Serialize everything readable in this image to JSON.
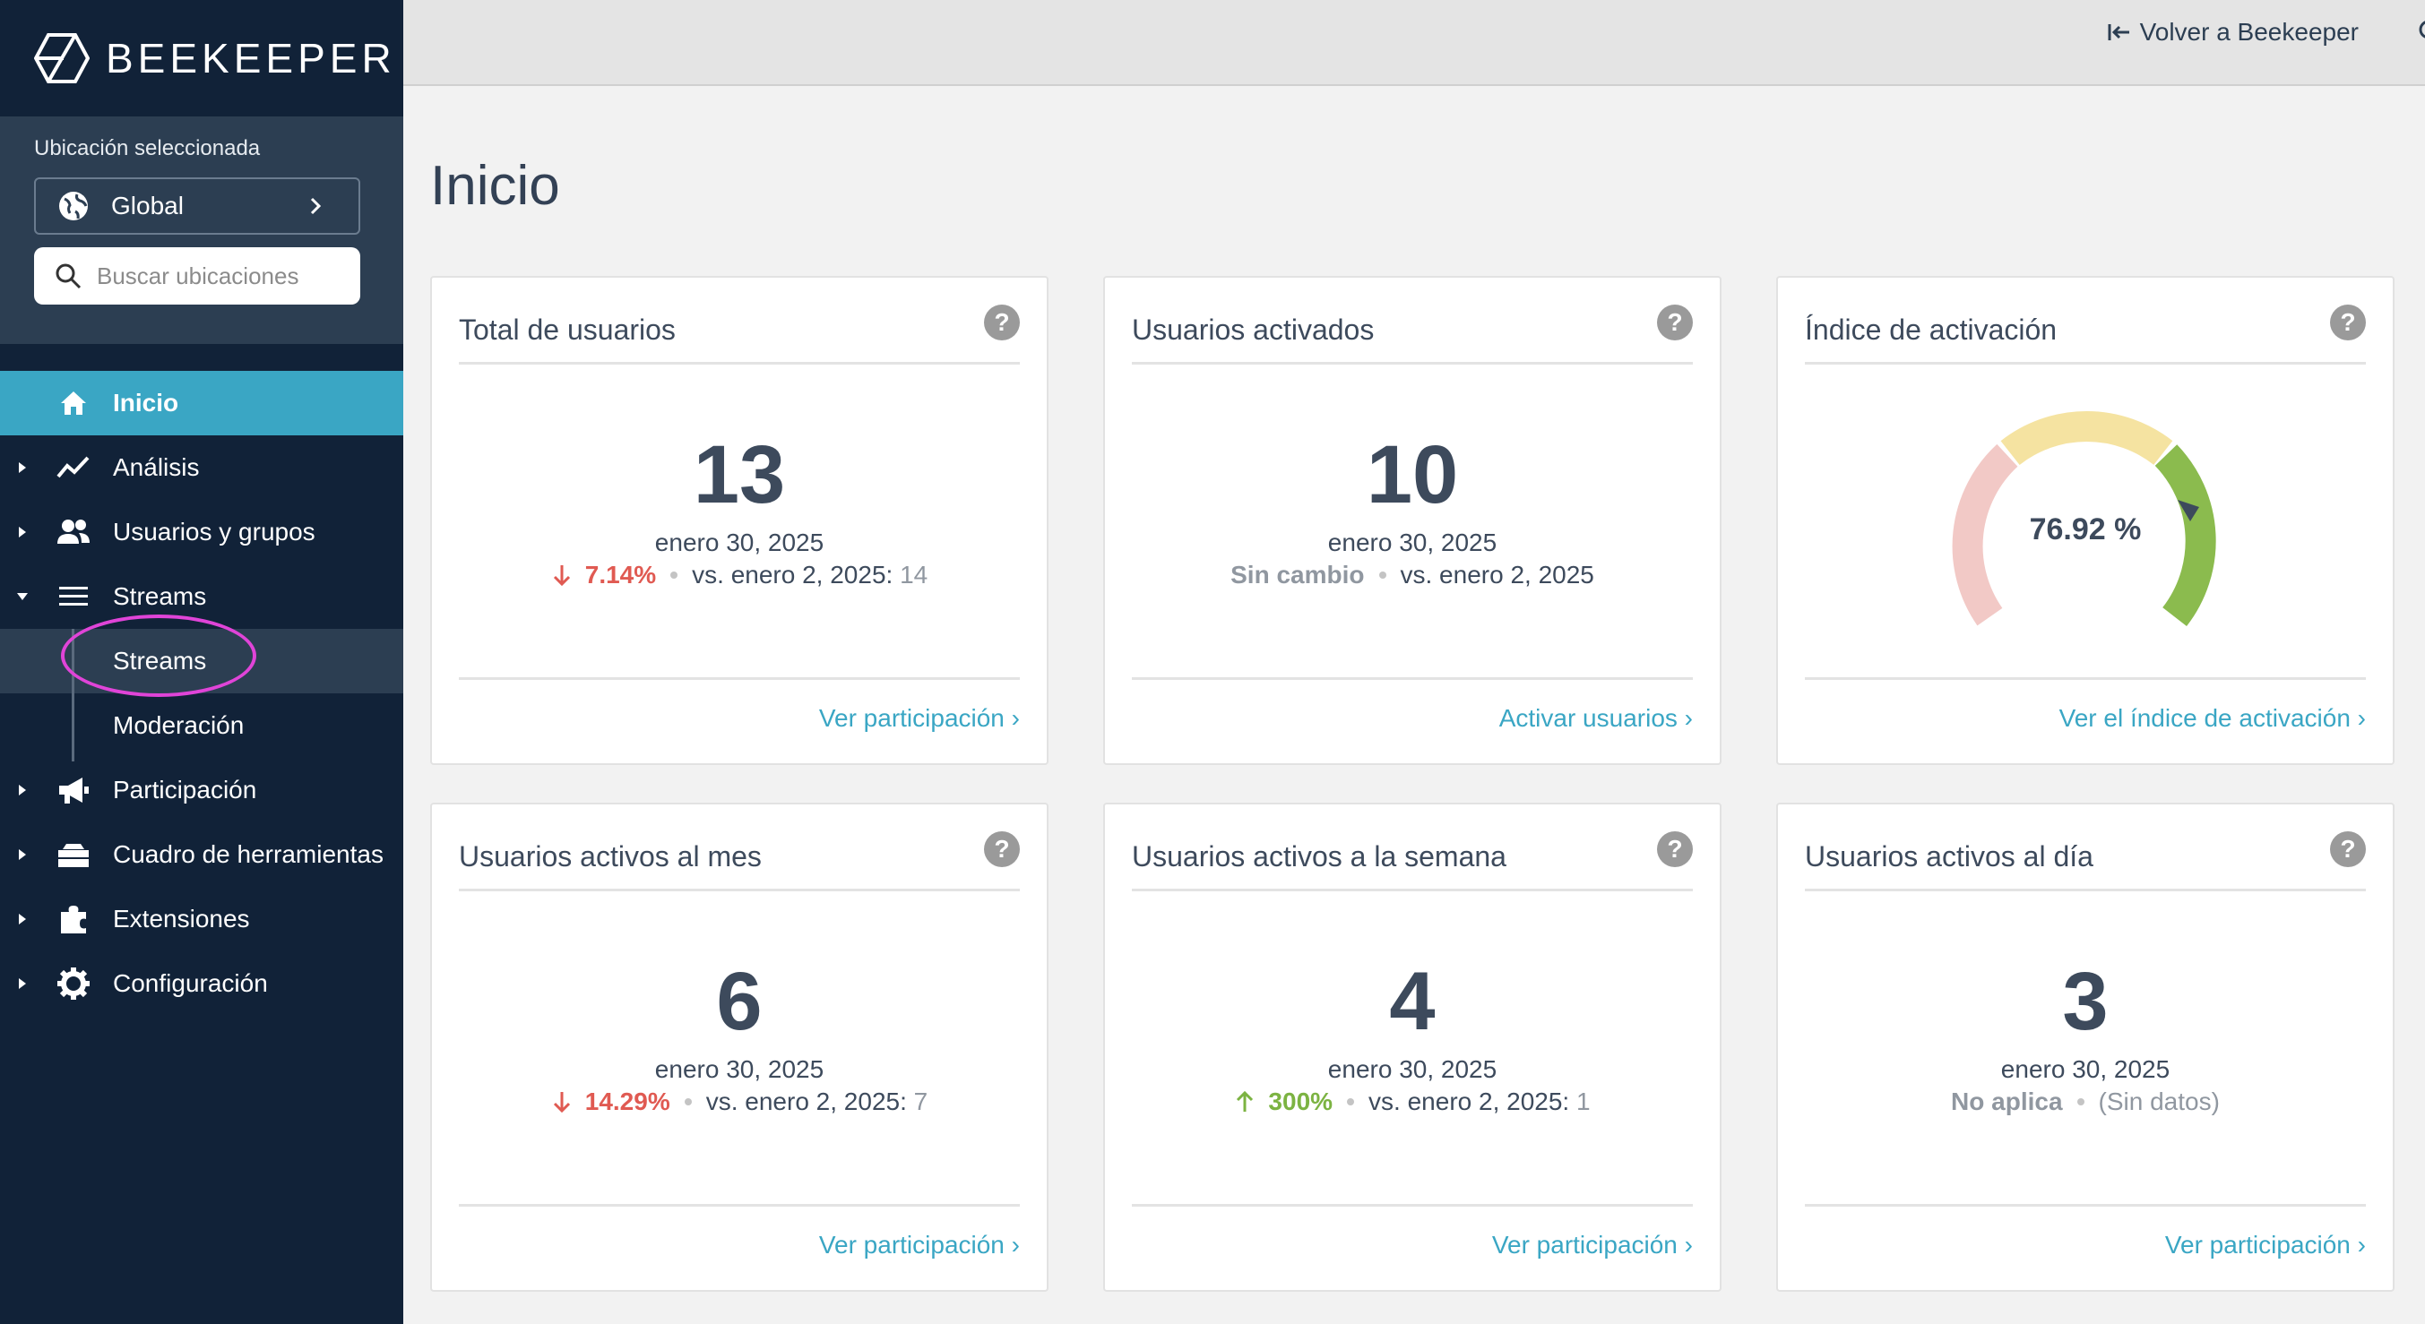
{
  "brand": {
    "name": "BEEKEEPER"
  },
  "location": {
    "label": "Ubicación seleccionada",
    "selected": "Global",
    "search_placeholder": "Buscar ubicaciones"
  },
  "nav": {
    "items": [
      {
        "label": "Inicio",
        "icon": "home-icon"
      },
      {
        "label": "Análisis",
        "icon": "chart-line-icon"
      },
      {
        "label": "Usuarios y grupos",
        "icon": "users-icon"
      },
      {
        "label": "Streams",
        "icon": "menu-lines-icon"
      },
      {
        "label": "Participación",
        "icon": "megaphone-icon"
      },
      {
        "label": "Cuadro de herramientas",
        "icon": "toolbox-icon"
      },
      {
        "label": "Extensiones",
        "icon": "puzzle-icon"
      },
      {
        "label": "Configuración",
        "icon": "gear-icon"
      }
    ],
    "streams_sub": [
      {
        "label": "Streams"
      },
      {
        "label": "Moderación"
      }
    ]
  },
  "topbar": {
    "back_label": "Volver a Beekeeper"
  },
  "page": {
    "title": "Inicio"
  },
  "cards": [
    {
      "title": "Total de usuarios",
      "value": "13",
      "date": "enero 30, 2025",
      "change": "7.14%",
      "change_dir": "down",
      "compare_label": "vs. enero 2, 2025:",
      "compare_value": "14",
      "link": "Ver participación"
    },
    {
      "title": "Usuarios activados",
      "value": "10",
      "date": "enero 30, 2025",
      "change": "Sin cambio",
      "change_dir": "none",
      "compare_label": "vs. enero 2, 2025",
      "compare_value": "",
      "link": "Activar usuarios"
    },
    {
      "title": "Índice de activación",
      "gauge_value": "76.92 %",
      "gauge_fraction": 0.7692,
      "link": "Ver el índice de activación"
    },
    {
      "title": "Usuarios activos al mes",
      "value": "6",
      "date": "enero 30, 2025",
      "change": "14.29%",
      "change_dir": "down",
      "compare_label": "vs. enero 2, 2025:",
      "compare_value": "7",
      "link": "Ver participación"
    },
    {
      "title": "Usuarios activos a la semana",
      "value": "4",
      "date": "enero 30, 2025",
      "change": "300%",
      "change_dir": "up",
      "compare_label": "vs. enero 2, 2025:",
      "compare_value": "1",
      "link": "Ver participación"
    },
    {
      "title": "Usuarios activos al día",
      "value": "3",
      "date": "enero 30, 2025",
      "change": "No aplica",
      "change_dir": "none",
      "compare_label": "(Sin datos)",
      "compare_value": "",
      "link": "Ver participación"
    }
  ],
  "colors": {
    "sidebar_bg": "#112238",
    "active_nav": "#3aa6c4",
    "link": "#3aa6c4",
    "down": "#e05a52",
    "up": "#7cb342",
    "gauge_red": "#f2c9c6",
    "gauge_yellow": "#f5e3a1",
    "gauge_green": "#8bbb4e",
    "highlight_ring": "#e044d8"
  }
}
